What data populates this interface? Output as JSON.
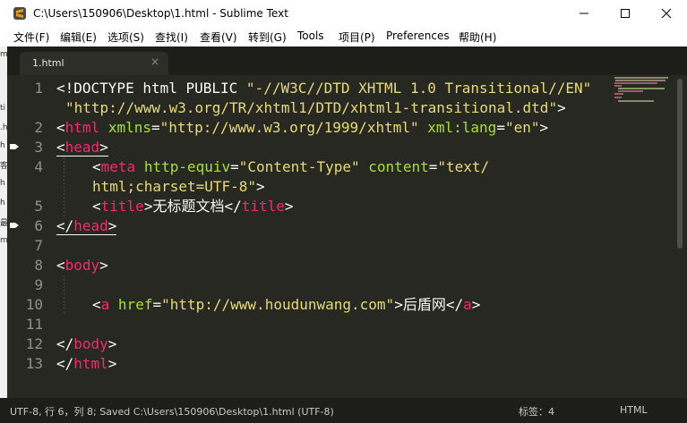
{
  "window": {
    "title": "C:\\Users\\150906\\Desktop\\1.html - Sublime Text",
    "minimize_icon": "minimize-icon",
    "maximize_icon": "maximize-icon",
    "close_icon": "close-icon"
  },
  "menu": [
    {
      "label": "文件(F)"
    },
    {
      "label": "编辑(E)"
    },
    {
      "label": "选项(S)"
    },
    {
      "label": "查找(I)"
    },
    {
      "label": "查看(V)"
    },
    {
      "label": "转到(G)"
    },
    {
      "label": "Tools"
    },
    {
      "label": "项目(P)"
    },
    {
      "label": "Preferences"
    },
    {
      "label": "帮助(H)"
    }
  ],
  "left_edge": [
    "m",
    "ti",
    ".h",
    "h",
    "客",
    "h",
    "h",
    "最",
    "m"
  ],
  "tab": {
    "label": "1.html",
    "close": "×"
  },
  "gutter": {
    "line_numbers": [
      "1",
      "2",
      "3",
      "4",
      "5",
      "6",
      "7",
      "8",
      "9",
      "10",
      "11",
      "12",
      "13"
    ],
    "bookmarked_lines": [
      "3",
      "6"
    ]
  },
  "code": {
    "l1a": {
      "p1": "<!DOCTYPE html PUBLIC ",
      "s1": "\"-//W3C//DTD XHTML 1.0 Transitional//EN\""
    },
    "l1b": {
      "s1": "\"http://www.w3.org/TR/xhtml1/DTD/xhtml1-transitional.dtd\"",
      "p1": ">"
    },
    "l2": {
      "p1": "<",
      "t1": "html",
      "p2": " ",
      "a1": "xmlns",
      "p3": "=",
      "s1": "\"http://www.w3.org/1999/xhtml\"",
      "p4": " ",
      "a2": "xml:lang",
      "p5": "=",
      "s2": "\"en\"",
      "p6": ">"
    },
    "l3": {
      "p1": "<",
      "t1": "head",
      "p2": ">"
    },
    "l4a": {
      "p1": "<",
      "t1": "meta",
      "p2": " ",
      "a1": "http-equiv",
      "p3": "=",
      "s1": "\"Content-Type\"",
      "p4": " ",
      "a2": "content",
      "p5": "=",
      "s2": "\"text/"
    },
    "l4b": {
      "s1": "html;charset=UTF-8\"",
      "p1": ">"
    },
    "l5": {
      "p1": "<",
      "t1": "title",
      "p2": ">无标题文档</",
      "t2": "title",
      "p3": ">"
    },
    "l6": {
      "p1": "</",
      "t1": "head",
      "p2": ">"
    },
    "l8": {
      "p1": "<",
      "t1": "body",
      "p2": ">"
    },
    "l10": {
      "p1": "<",
      "t1": "a",
      "p2": " ",
      "a1": "href",
      "p3": "=",
      "s1": "\"http://www.houdunwang.com\"",
      "p4": ">后盾网</",
      "t2": "a",
      "p5": ">"
    },
    "l12": {
      "p1": "</",
      "t1": "body",
      "p2": ">"
    },
    "l13": {
      "p1": "</",
      "t1": "html",
      "p2": ">"
    }
  },
  "status": {
    "left": "UTF-8, 行 6，列 8; Saved C:\\Users\\150906\\Desktop\\1.html (UTF-8)",
    "tab_size": "标签：4",
    "syntax": "HTML"
  },
  "colors": {
    "background": "#272822",
    "tag": "#f92672",
    "attribute": "#a6e22e",
    "string": "#e6db74",
    "text": "#f8f8f2",
    "gutter_text": "#90908a"
  }
}
